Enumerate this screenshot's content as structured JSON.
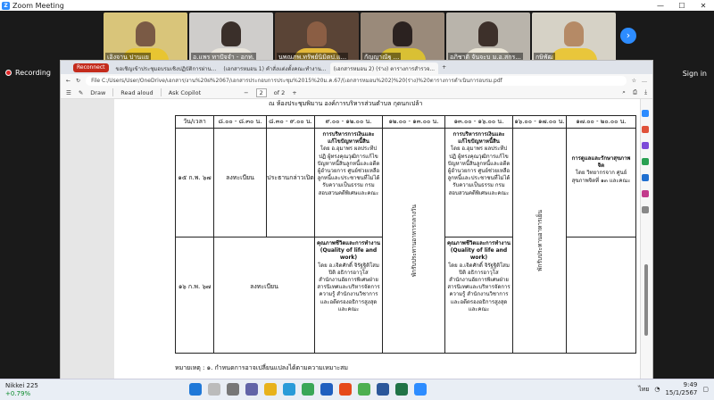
{
  "zoom": {
    "title": "Zoom Meeting",
    "recording_label": "Recording",
    "signin_label": "Sign in",
    "next_icon": "chevron-right-icon",
    "participants": [
      {
        "name": "เอิงจาน ปานแย"
      },
      {
        "name": "อ.แพร ทาปัจจำ - อกท."
      },
      {
        "name": "นพณภพ.ทรัพย์นิมิตป.แ..."
      },
      {
        "name": "กัญญาณัฐ ..."
      },
      {
        "name": "อภิชาติ จันจะบ ม.อ.สกร..."
      },
      {
        "name": "กษิพัฒ"
      }
    ]
  },
  "browser": {
    "reconnect_label": "Reconnect",
    "tabs": [
      {
        "label": "ขอเชิญเข้าประชุมอบรมเชิงปฏิบัติการผ่าน..."
      },
      {
        "label": "(เอกสารหมอน 1) คำสั่งแต่งตั้งคณะทำงาน..."
      },
      {
        "label": "(เอกสารหมอน 2) (ร่าง) ตารางการสำรวจ..."
      }
    ],
    "address": "File   C:/Users/User/OneDrive/เอกสาร/งาน%20ฝ%2067/เอกสารประกอบการประชุม%2015%20ม.ค.67/(เอกสารหมอน%202)%20(ร่าง)%20ตารางการดำเนินการอบรม.pdf",
    "pdf_toolbar": {
      "draw_label": "Draw",
      "read_aloud_label": "Read aloud",
      "ask_copilot_label": "Ask Copilot",
      "page_current": "2",
      "page_total": "of 2"
    }
  },
  "document": {
    "heading": "ณ ห้องประชุมพิมาน องค์การบริหารส่วนตำบล กุดนกเปล้า",
    "table": {
      "headers": [
        "วัน/เวลา",
        "๘.๐๐ - ๘.๓๐ น.",
        "๘.๓๐ - ๙.๐๐ น.",
        "๙.๐๐ - ๑๒.๐๐ น.",
        "๑๒.๐๐ - ๑๓.๐๐ น.",
        "๑๓.๐๐ - ๑๖.๐๐ น.",
        "๑๖.๐๐ - ๑๗.๐๐ น.",
        "๑๗.๐๐ - ๒๐.๐๐ น."
      ],
      "rows": [
        {
          "date": "๑๕ ก.พ. ๖๗",
          "c1": "ลงทะเบียน",
          "c2": "ประธานกล่าวเปิด",
          "morning_title": "การบริหารการเงินและแก้ไขปัญหาหนี้สิน",
          "morning_body": "โดย อ.อุมาพร ผลประทีปปฏิ ผู้ทรงคุณวุฒิการแก้ไขปัญหาหนี้สินลูกหนี้และอดีตผู้อำนวยการ ศูนย์ช่วยเหลือลูกหนี้และประชาชนที่ไม่ได้รับความเป็นธรรม กรมสอบสวนคดีพิเศษและคณะ",
          "lunch": "พักรับประทานอาหารกลางวัน",
          "afternoon_title": "การบริหารการเงินและแก้ไขปัญหาหนี้สิน",
          "afternoon_body": "โดย อ.อุมาพร ผลประทีปปฏิ ผู้ทรงคุณวุฒิการแก้ไขปัญหาหนี้สินลูกหนี้และอดีตผู้อำนวยการ ศูนย์ช่วยเหลือลูกหนี้และประชาชนที่ไม่ได้รับความเป็นธรรม กรมสอบสวนคดีพิเศษและคณะ",
          "evening_break": "พักรับประทานอาหารเย็น",
          "evening_title": "การดูแลและรักษาสุขภาพจิต",
          "evening_body": "โดย วิทยากรจาก ศูนย์สุขภาพจิตที่ ๑๓ และคณะ"
        },
        {
          "date": "๑๖ ก.พ. ๖๗",
          "c1": "ลงทะเบียน",
          "morning_title": "คุณภาพชีวิตและการทำงาน (Quality of life and work)",
          "morning_body": "โดย อ.เจิดศักดิ์ จิรัฐฐิติโสมปิติ อธิการอาวุโส สำนักงานอัยการพิเศษฝ่ายสารนิเทศและบริหารจัดการความรู้ สำนักงานวิชาการ และอดีตรองอธิการสูงสุดและคณะ",
          "afternoon_title": "คุณภาพชีวิตและการทำงาน (Quality of life and work)",
          "afternoon_body": "โดย อ.เจิดศักดิ์ จิรัฐฐิติโสมปิติ อธิการอาวุโส สำนักงานอัยการพิเศษฝ่ายสารนิเทศและบริหารจัดการความรู้ สำนักงานวิชาการ และอดีตรองอธิการสูงสุดและคณะ"
        }
      ]
    },
    "note": "หมายเหตุ : ๑. กำหนดการอาจเปลี่ยนแปลงได้ตามความเหมาะสม"
  },
  "taskbar": {
    "stock_name": "Nikkei 225",
    "stock_change": "+0.79%",
    "language": "ไทย",
    "time": "9:49",
    "date": "15/1/2567"
  },
  "colors": {
    "zoom_blue": "#2d8cff",
    "reconnect_red": "#c42b1c",
    "stock_green": "#0a8a2a"
  }
}
